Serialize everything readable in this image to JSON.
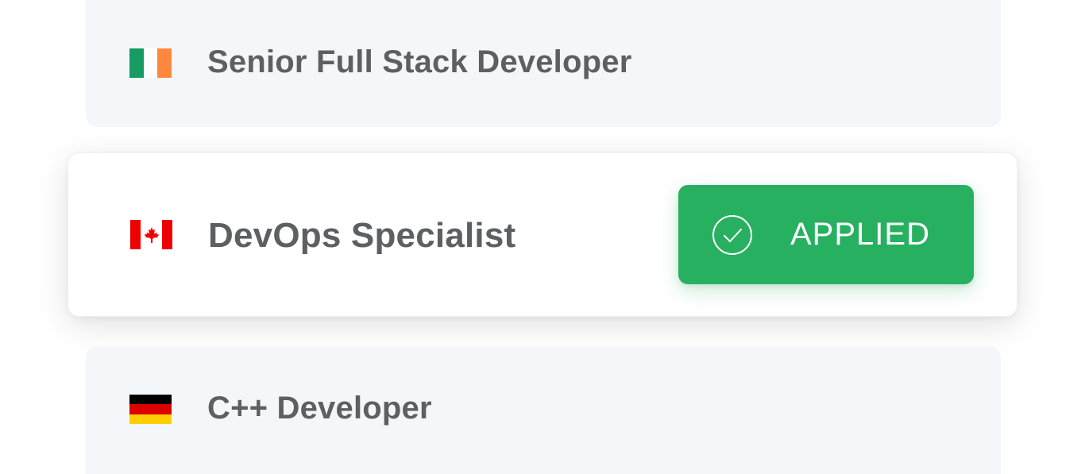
{
  "jobs": [
    {
      "title": "Senior Full Stack Developer",
      "flag_icon": "ireland-flag-icon",
      "flag_colors": [
        "#169b62",
        "#ffffff",
        "#ff883e"
      ]
    },
    {
      "title": "DevOps Specialist",
      "flag_icon": "canada-flag-icon",
      "flag_colors": [
        "#ee0000",
        "#ffffff",
        "#ee0000"
      ],
      "status": {
        "label": "APPLIED",
        "icon": "check-circle-icon",
        "color": "#28b061"
      }
    },
    {
      "title": "C++ Developer",
      "flag_icon": "germany-flag-icon",
      "flag_colors": [
        "#000000",
        "#dd0000",
        "#ffce00"
      ]
    }
  ]
}
